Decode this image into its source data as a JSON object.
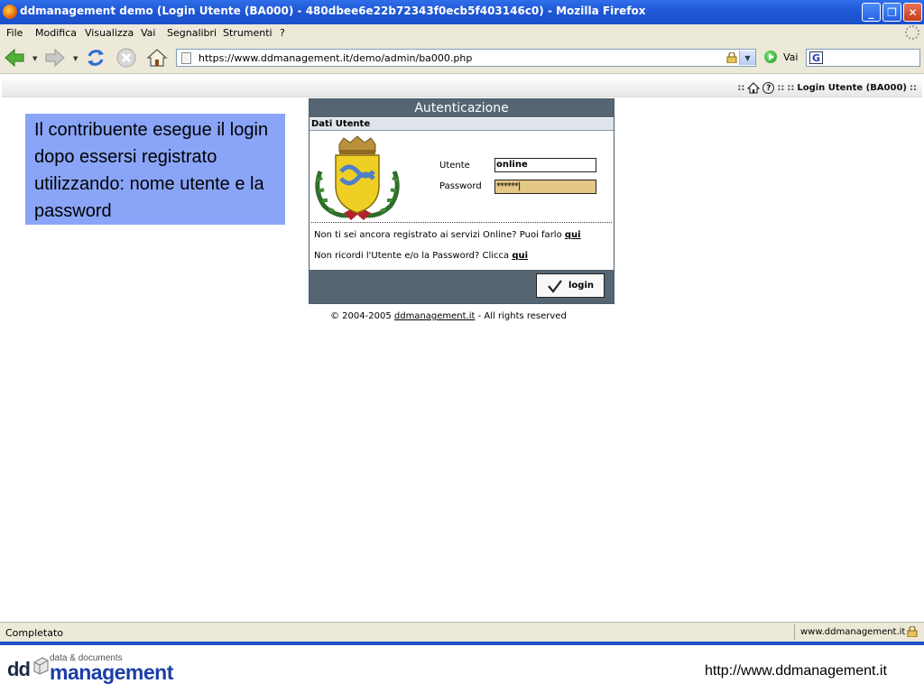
{
  "window": {
    "title": "ddmanagement demo (Login Utente (BA000) - 480dbee6e22b72343f0ecb5f403146c0) - Mozilla Firefox",
    "minimize_label": "_",
    "maximize_label": "❐",
    "close_label": "✕"
  },
  "menu": {
    "items": [
      "File",
      "Modifica",
      "Visualizza",
      "Vai",
      "Segnalibri",
      "Strumenti",
      "?"
    ]
  },
  "navbar": {
    "url": "https://www.ddmanagement.it/demo/admin/ba000.php",
    "go_label": "Vai",
    "search_engine_letter": "G"
  },
  "page": {
    "breadcrumb": {
      "separator": "::",
      "title": "Login Utente (BA000)"
    },
    "note": "Il contribuente esegue il login dopo essersi registrato utilizzando: nome utente e la password",
    "login": {
      "header": "Autenticazione",
      "section": "Dati Utente",
      "user_label": "Utente",
      "user_value": "online",
      "password_label": "Password",
      "password_value": "******|",
      "register_text": "Non ti sei ancora registrato ai servizi Online? Puoi farlo",
      "forgot_text": "Non ricordi l'Utente e/o la Password? Clicca",
      "link_text": "qui",
      "button_label": "login"
    },
    "copyright": {
      "prefix": "© 2004-2005",
      "link": "ddmanagement.it",
      "suffix": "- All rights reserved"
    }
  },
  "status": {
    "text": "Completato",
    "host": "www.ddmanagement.it"
  },
  "footer": {
    "logo_prefix": "dd",
    "logo_small": "data & documents",
    "logo_main": "management",
    "url": "http://www.ddmanagement.it"
  },
  "colors": {
    "titlebar": "#1f57d6",
    "note_bg": "#8aa5f7",
    "panel_header": "#556573",
    "password_bg": "#e6c886",
    "footer_line": "#1f52c7"
  }
}
